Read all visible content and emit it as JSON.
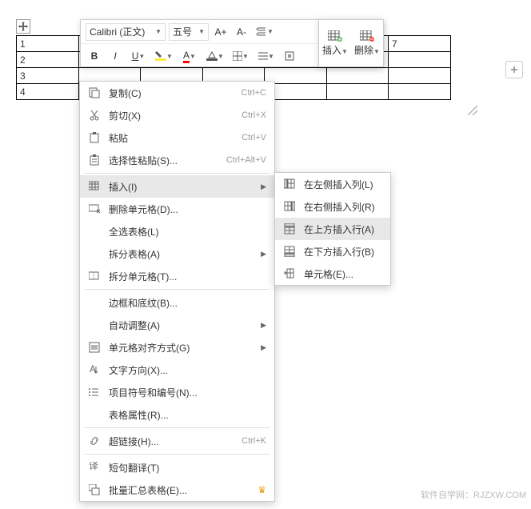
{
  "toolbar": {
    "font_name": "Calibri (正文)",
    "font_size": "五号",
    "insert_label": "插入",
    "delete_label": "删除"
  },
  "table": {
    "rows": [
      "1",
      "2",
      "3",
      "4"
    ],
    "cell_r1c7": "7"
  },
  "context_menu": {
    "items": [
      {
        "label": "复制(C)",
        "shortcut": "Ctrl+C"
      },
      {
        "label": "剪切(X)",
        "shortcut": "Ctrl+X"
      },
      {
        "label": "粘贴",
        "shortcut": "Ctrl+V"
      },
      {
        "label": "选择性粘贴(S)...",
        "shortcut": "Ctrl+Alt+V"
      },
      {
        "label": "插入(I)",
        "submenu": true,
        "hover": true
      },
      {
        "label": "删除单元格(D)..."
      },
      {
        "label": "全选表格(L)"
      },
      {
        "label": "拆分表格(A)",
        "submenu": true
      },
      {
        "label": "拆分单元格(T)..."
      },
      {
        "label": "边框和底纹(B)..."
      },
      {
        "label": "自动调整(A)",
        "submenu": true
      },
      {
        "label": "单元格对齐方式(G)",
        "submenu": true
      },
      {
        "label": "文字方向(X)..."
      },
      {
        "label": "项目符号和编号(N)..."
      },
      {
        "label": "表格属性(R)..."
      },
      {
        "label": "超链接(H)...",
        "shortcut": "Ctrl+K"
      },
      {
        "label": "短句翻译(T)"
      },
      {
        "label": "批量汇总表格(E)...",
        "crown": true
      }
    ]
  },
  "submenu": {
    "items": [
      {
        "label": "在左侧插入列(L)"
      },
      {
        "label": "在右侧插入列(R)"
      },
      {
        "label": "在上方插入行(A)",
        "hover": true
      },
      {
        "label": "在下方插入行(B)"
      },
      {
        "label": "单元格(E)..."
      }
    ]
  },
  "watermark": "软件自学网：RJZXW.COM"
}
